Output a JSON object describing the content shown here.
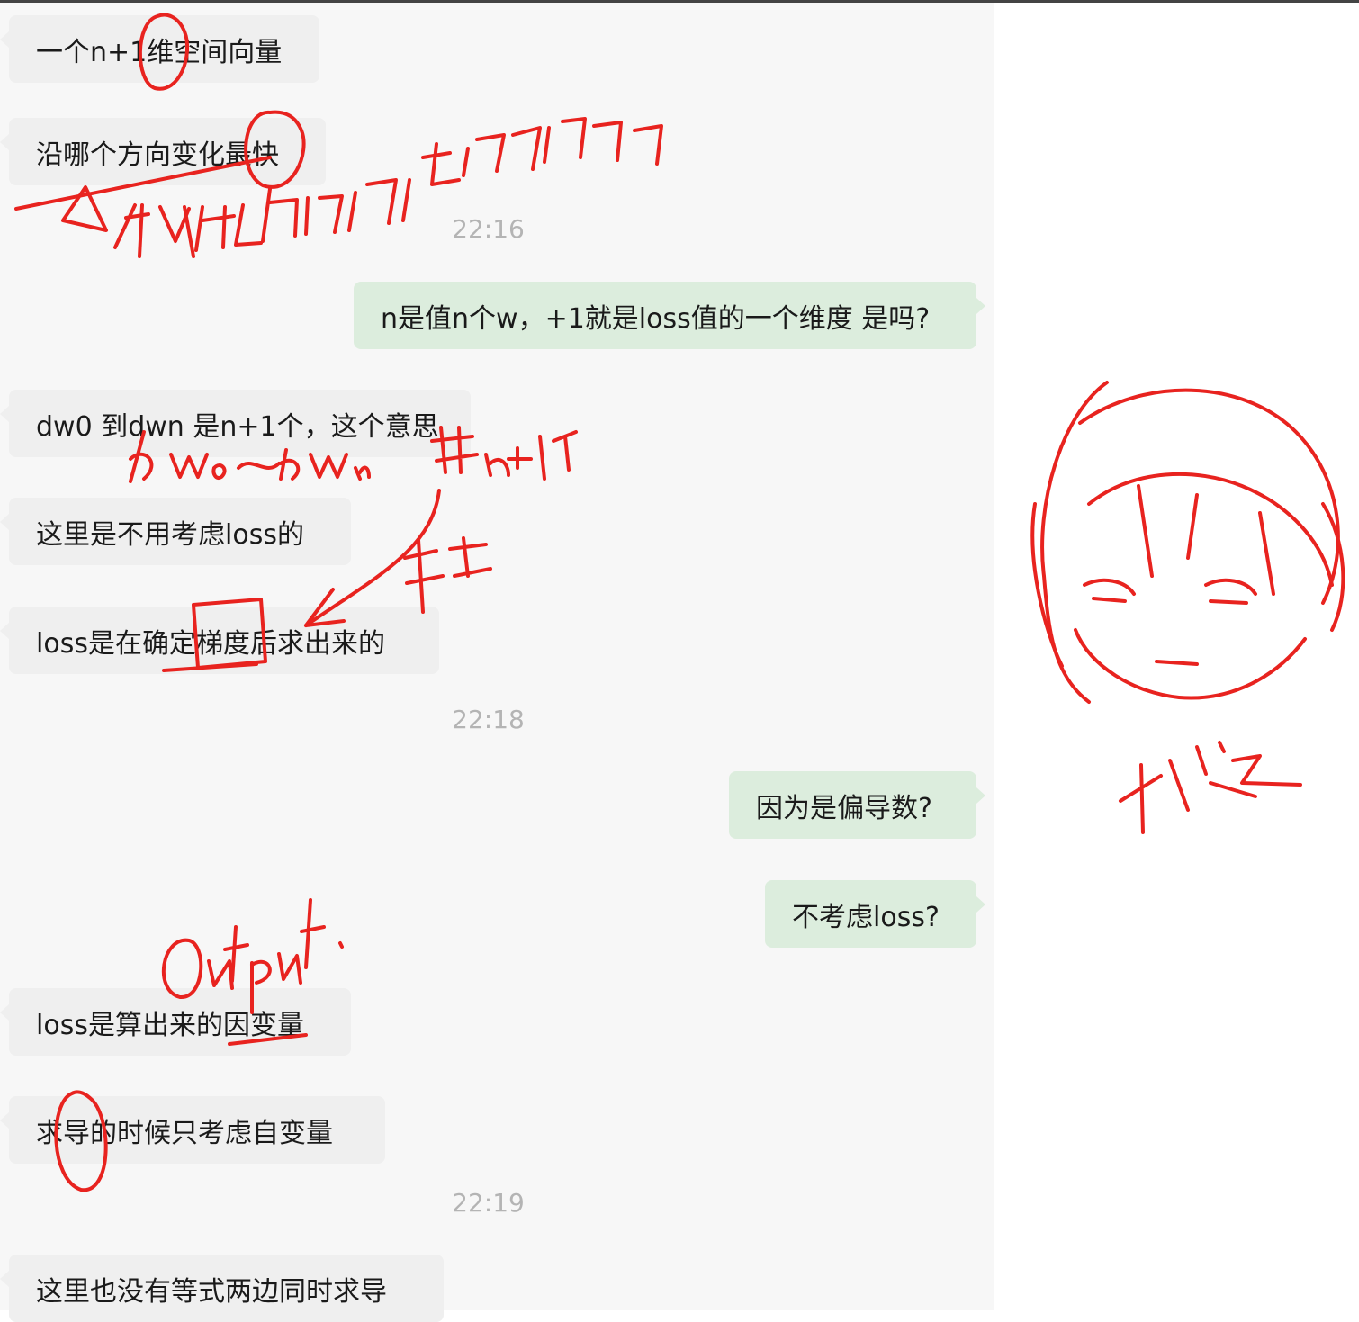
{
  "messages": [
    {
      "side": "in",
      "text": "一个n+1维空间向量"
    },
    {
      "side": "in",
      "text": "沿哪个方向变化最快"
    },
    {
      "side": "out",
      "text": "n是值n个w，+1就是loss值的一个维度 是吗?"
    },
    {
      "side": "in",
      "text": "dw0 到dwn 是n+1个，这个意思"
    },
    {
      "side": "in",
      "text": "这里是不用考虑loss的"
    },
    {
      "side": "in",
      "text": "loss是在确定梯度后求出来的"
    },
    {
      "side": "out",
      "text": "因为是偏导数?"
    },
    {
      "side": "out",
      "text": "不考虑loss?"
    },
    {
      "side": "in",
      "text": "loss是算出来的因变量"
    },
    {
      "side": "in",
      "text": "求导的时候只考虑自变量"
    },
    {
      "side": "in",
      "text": "这里也没有等式两边同时求导"
    }
  ],
  "timestamps": [
    "22:16",
    "22:18",
    "22:19"
  ],
  "annotations": {
    "ink_color": "#e8231f",
    "handwritten": [
      "指所有的向量和 起来 哪个方向",
      "dw0 ~ dwn 共n+1个",
      "求去",
      "output."
    ]
  }
}
